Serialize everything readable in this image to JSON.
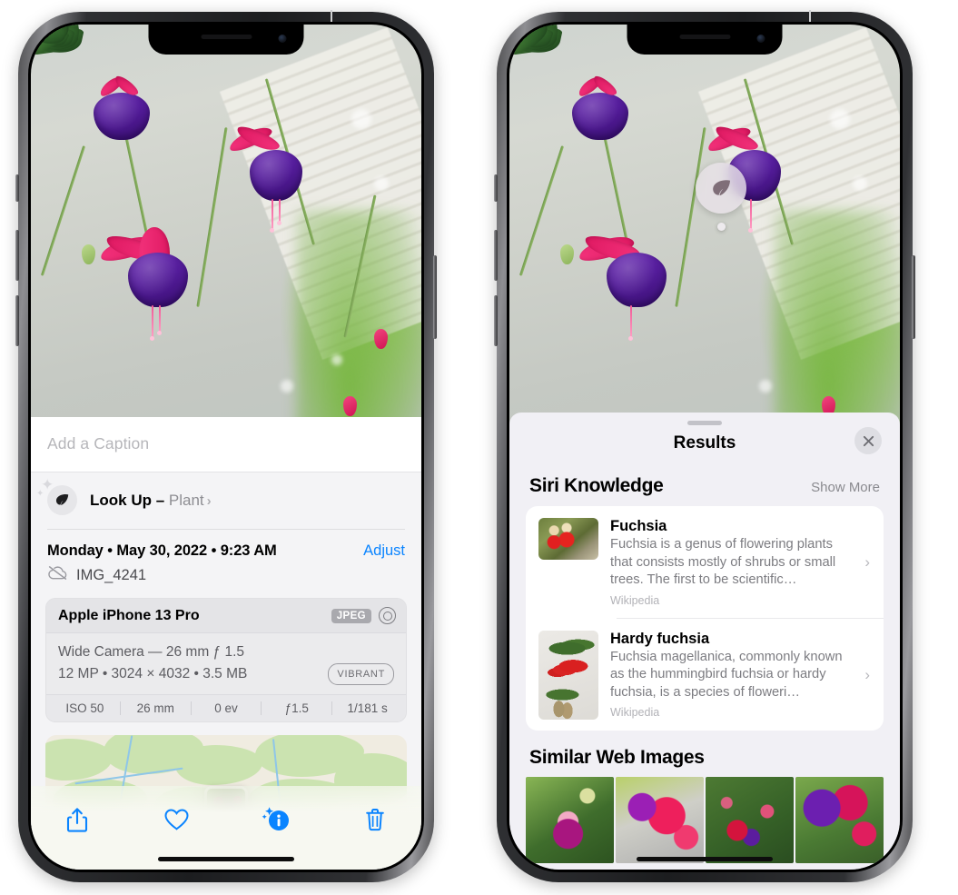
{
  "left_phone": {
    "photo": {
      "alt": "fuchsia-plant-photo"
    },
    "caption": {
      "placeholder": "Add a Caption",
      "value": ""
    },
    "lookup": {
      "icon": "leaf-icon",
      "label_bold": "Look Up – ",
      "label_plain": "Plant",
      "chevron": "›"
    },
    "date_row": {
      "date": "Monday • May 30, 2022 • 9:23 AM",
      "adjust_label": "Adjust"
    },
    "file_row": {
      "icon": "cloud-slash-icon",
      "filename": "IMG_4241"
    },
    "metadata": {
      "device": "Apple iPhone 13 Pro",
      "format_chip": "JPEG",
      "aperture_icon": "aperture-icon",
      "lens": "Wide Camera — 26 mm ƒ 1.5",
      "size_line": "12 MP  •  3024 × 4032  •  3.5 MB",
      "style_chip": "VIBRANT",
      "exif": [
        "ISO 50",
        "26 mm",
        "0 ev",
        "ƒ1.5",
        "1/181 s"
      ]
    },
    "map": {
      "name": "location-map"
    },
    "toolbar": [
      {
        "name": "share-button",
        "icon": "share-icon"
      },
      {
        "name": "favorite-button",
        "icon": "heart-icon"
      },
      {
        "name": "info-button",
        "icon": "info-sparkle-icon"
      },
      {
        "name": "delete-button",
        "icon": "trash-icon"
      }
    ],
    "accent_color": "#0a84ff"
  },
  "right_phone": {
    "visual_lookup_badge": {
      "icon": "leaf-icon"
    },
    "sheet": {
      "title": "Results",
      "close_icon": "close-icon",
      "grabber": "drag-handle"
    },
    "siri_knowledge": {
      "section_title": "Siri Knowledge",
      "show_more": "Show More",
      "items": [
        {
          "title": "Fuchsia",
          "description": "Fuchsia is a genus of flowering plants that consists mostly of shrubs or small trees. The first to be scientific…",
          "source": "Wikipedia",
          "thumb": "fuchsia-red-flowers-thumb",
          "chevron": "›"
        },
        {
          "title": "Hardy fuchsia",
          "description": "Fuchsia magellanica, commonly known as the hummingbird fuchsia or hardy fuchsia, is a species of floweri…",
          "source": "Wikipedia",
          "thumb": "hardy-fuchsia-specimen-thumb",
          "chevron": "›"
        }
      ]
    },
    "similar_web_images": {
      "section_title": "Similar Web Images",
      "items": [
        {
          "name": "similar-image-1"
        },
        {
          "name": "similar-image-2"
        },
        {
          "name": "similar-image-3"
        },
        {
          "name": "similar-image-4"
        }
      ]
    }
  }
}
